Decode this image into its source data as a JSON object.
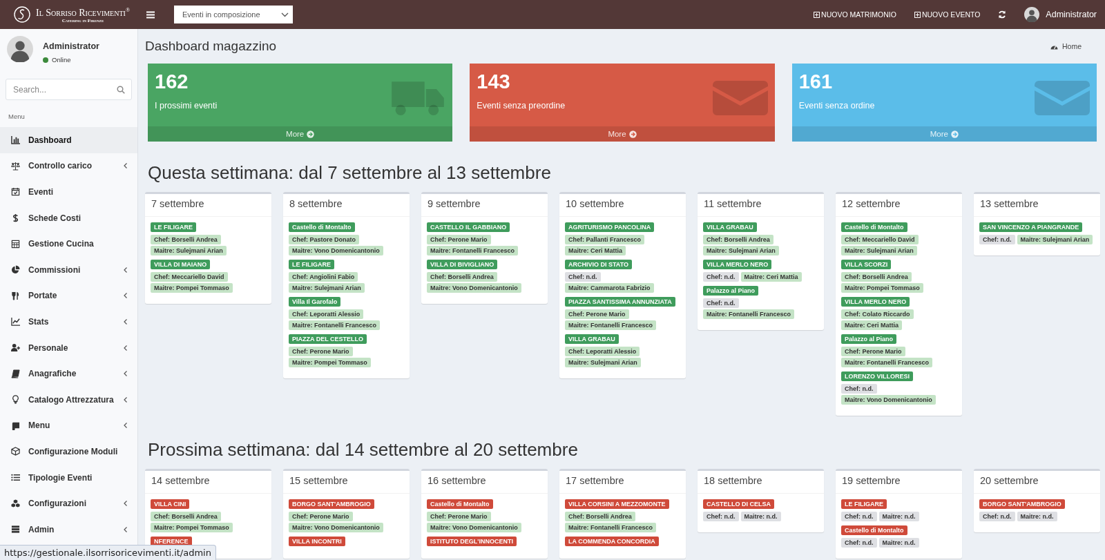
{
  "header": {
    "logo": {
      "name": "Il Sorriso Ricevimenti$^{®}$",
      "tagline": "Catering in Firenze"
    },
    "filter": {
      "value": "Eventi in composizione"
    },
    "actions": [
      {
        "label": "NUOVO MATRIMONIO"
      },
      {
        "label": "NUOVO EVENTO"
      }
    ],
    "user": "Administrator"
  },
  "sidebar": {
    "user": {
      "name": "Administrator",
      "status": "Online",
      "online": true
    },
    "search": {
      "placeholder": "Search..."
    },
    "section": "Menu",
    "items": [
      {
        "label": "Dashboard",
        "kind": "bar-chart",
        "submenu": false,
        "selected": true
      },
      {
        "label": "Controllo carico",
        "kind": "scale",
        "submenu": true,
        "selected": false
      },
      {
        "label": "Eventi",
        "kind": "calendar",
        "submenu": false,
        "selected": false
      },
      {
        "label": "Schede Costi",
        "kind": "dollar",
        "submenu": false,
        "selected": false
      },
      {
        "label": "Gestione Cucina",
        "kind": "calculator",
        "submenu": false,
        "selected": false
      },
      {
        "label": "Commissioni",
        "kind": "pie",
        "submenu": true,
        "selected": false
      },
      {
        "label": "Portate",
        "kind": "utensils",
        "submenu": true,
        "selected": false
      },
      {
        "label": "Stats",
        "kind": "line-chart",
        "submenu": true,
        "selected": false
      },
      {
        "label": "Personale",
        "kind": "user-plus",
        "submenu": true,
        "selected": false
      },
      {
        "label": "Anagrafiche",
        "kind": "book",
        "submenu": true,
        "selected": false
      },
      {
        "label": "Catalogo Attrezzatura",
        "kind": "bulb",
        "submenu": true,
        "selected": false
      },
      {
        "label": "Menu",
        "kind": "scroll",
        "submenu": true,
        "selected": false
      },
      {
        "label": "Configurazione Moduli",
        "kind": "cube",
        "submenu": false,
        "selected": false
      },
      {
        "label": "Tipologie Eventi",
        "kind": "list",
        "submenu": false,
        "selected": false
      },
      {
        "label": "Configurazioni",
        "kind": "cubes",
        "submenu": true,
        "selected": false
      },
      {
        "label": "Admin",
        "kind": "server",
        "submenu": true,
        "selected": false
      }
    ]
  },
  "page": {
    "title": "Dashboard magazzino",
    "breadcrumb": "Home"
  },
  "stats": [
    {
      "value": "162",
      "label": "I prossimi eventi",
      "link": "More",
      "kind": "truck",
      "color": "#4aa563"
    },
    {
      "value": "143",
      "label": "Eventi senza preordine",
      "link": "More",
      "kind": "envelope",
      "color": "#d65a46"
    },
    {
      "value": "161",
      "label": "Eventi senza ordine",
      "link": "More",
      "kind": "envelope",
      "color": "#5bbde9"
    }
  ],
  "weeks": [
    {
      "title": "Questa settimana: dal 7 settembre al 13 settembre",
      "days": [
        {
          "date": "7 settembre",
          "events": [
            {
              "venue": "LE FILIGARE",
              "color": "#3f9c5c",
              "staff": [
                {
                  "text": "Chef: Borselli Andrea",
                  "assigned": true
                },
                {
                  "text": "Maitre: Sulejmani Arian",
                  "assigned": true
                }
              ]
            },
            {
              "venue": "VILLA DI MAIANO",
              "color": "#3f9c5c",
              "staff": [
                {
                  "text": "Chef: Meccariello David",
                  "assigned": true
                },
                {
                  "text": "Maitre: Pompei Tommaso",
                  "assigned": true
                }
              ]
            }
          ]
        },
        {
          "date": "8 settembre",
          "events": [
            {
              "venue": "Castello di Montalto",
              "color": "#3f9c5c",
              "staff": [
                {
                  "text": "Chef: Pastore Donato",
                  "assigned": true
                },
                {
                  "text": "Maitre: Vono Domenicantonio",
                  "assigned": true
                }
              ]
            },
            {
              "venue": "LE FILIGARE",
              "color": "#3f9c5c",
              "staff": [
                {
                  "text": "Chef: Angiolini Fabio",
                  "assigned": true
                },
                {
                  "text": "Maitre: Sulejmani Arian",
                  "assigned": true
                }
              ]
            },
            {
              "venue": "Villa Il Garofalo",
              "color": "#3f9c5c",
              "staff": [
                {
                  "text": "Chef: Leporatti Alessio",
                  "assigned": true
                },
                {
                  "text": "Maitre: Fontanelli Francesco",
                  "assigned": true
                }
              ]
            },
            {
              "venue": "PIAZZA DEL CESTELLO",
              "color": "#3f9c5c",
              "staff": [
                {
                  "text": "Chef: Perone Mario",
                  "assigned": true
                },
                {
                  "text": "Maitre: Pompei Tommaso",
                  "assigned": true
                }
              ]
            }
          ]
        },
        {
          "date": "9 settembre",
          "events": [
            {
              "venue": "CASTELLO IL GABBIANO",
              "color": "#3f9c5c",
              "staff": [
                {
                  "text": "Chef: Perone Mario",
                  "assigned": true
                },
                {
                  "text": "Maitre: Fontanelli Francesco",
                  "assigned": true
                }
              ]
            },
            {
              "venue": "VILLA DI BIVIGLIANO",
              "color": "#3f9c5c",
              "staff": [
                {
                  "text": "Chef: Borselli Andrea",
                  "assigned": true
                },
                {
                  "text": "Maitre: Vono Domenicantonio",
                  "assigned": true
                }
              ]
            }
          ]
        },
        {
          "date": "10 settembre",
          "events": [
            {
              "venue": "AGRITURISMO PANCOLINA",
              "color": "#3f9c5c",
              "staff": [
                {
                  "text": "Chef: Pallanti Francesco",
                  "assigned": true
                },
                {
                  "text": "Maitre: Ceri Mattia",
                  "assigned": true
                }
              ]
            },
            {
              "venue": "ARCHIVIO DI STATO",
              "color": "#3f9c5c",
              "staff": [
                {
                  "text": "Chef: n.d.",
                  "assigned": false
                },
                {
                  "text": "Maitre: Cammarota Fabrizio",
                  "assigned": true
                }
              ]
            },
            {
              "venue": "PIAZZA SANTISSIMA ANNUNZIATA",
              "color": "#3f9c5c",
              "staff": [
                {
                  "text": "Chef: Perone Mario",
                  "assigned": true
                },
                {
                  "text": "Maitre: Fontanelli Francesco",
                  "assigned": true
                }
              ]
            },
            {
              "venue": "VILLA GRABAU",
              "color": "#3f9c5c",
              "staff": [
                {
                  "text": "Chef: Leporatti Alessio",
                  "assigned": true
                },
                {
                  "text": "Maitre: Sulejmani Arian",
                  "assigned": true
                }
              ]
            }
          ]
        },
        {
          "date": "11 settembre",
          "events": [
            {
              "venue": "VILLA GRABAU",
              "color": "#3f9c5c",
              "staff": [
                {
                  "text": "Chef: Borselli Andrea",
                  "assigned": true
                },
                {
                  "text": "Maitre: Sulejmani Arian",
                  "assigned": true
                }
              ]
            },
            {
              "venue": "VILLA MERLO NERO",
              "color": "#3f9c5c",
              "staff": [
                {
                  "text": "Chef: n.d.",
                  "assigned": false
                },
                {
                  "text": "Maitre: Ceri Mattia",
                  "assigned": true
                }
              ]
            },
            {
              "venue": "Palazzo al Piano",
              "color": "#3f9c5c",
              "staff": [
                {
                  "text": "Chef: n.d.",
                  "assigned": false
                },
                {
                  "text": "Maitre: Fontanelli Francesco",
                  "assigned": true
                }
              ]
            }
          ]
        },
        {
          "date": "12 settembre",
          "events": [
            {
              "venue": "Castello di Montalto",
              "color": "#3f9c5c",
              "staff": [
                {
                  "text": "Chef: Meccariello David",
                  "assigned": true
                },
                {
                  "text": "Maitre: Sulejmani Arian",
                  "assigned": true
                }
              ]
            },
            {
              "venue": "VILLA SCORZI",
              "color": "#3f9c5c",
              "staff": [
                {
                  "text": "Chef: Borselli Andrea",
                  "assigned": true
                },
                {
                  "text": "Maitre: Pompei Tommaso",
                  "assigned": true
                }
              ]
            },
            {
              "venue": "VILLA MERLO NERO",
              "color": "#3f9c5c",
              "staff": [
                {
                  "text": "Chef: Colato Riccardo",
                  "assigned": true
                },
                {
                  "text": "Maitre: Ceri Mattia",
                  "assigned": true
                }
              ]
            },
            {
              "venue": "Palazzo al Piano",
              "color": "#3f9c5c",
              "staff": [
                {
                  "text": "Chef: Perone Mario",
                  "assigned": true
                },
                {
                  "text": "Maitre: Fontanelli Francesco",
                  "assigned": true
                }
              ]
            },
            {
              "venue": "LORENZO VILLORESI",
              "color": "#3f9c5c",
              "staff": [
                {
                  "text": "Chef: n.d.",
                  "assigned": false
                },
                {
                  "text": "Maitre: Vono Domenicantonio",
                  "assigned": true
                }
              ]
            }
          ]
        },
        {
          "date": "13 settembre",
          "events": [
            {
              "venue": "SAN VINCENZO A PIANGRANDE",
              "color": "#3f9c5c",
              "staff": [
                {
                  "text": "Chef: n.d.",
                  "assigned": false
                },
                {
                  "text": "Maitre: Sulejmani Arian",
                  "assigned": true
                }
              ]
            }
          ]
        }
      ]
    },
    {
      "title": "Prossima settimana: dal 14 settembre al 20 settembre",
      "days": [
        {
          "date": "14 settembre",
          "events": [
            {
              "venue": "VILLA CINI",
              "color": "#cf4a3a",
              "staff": [
                {
                  "text": "Chef: Borselli Andrea",
                  "assigned": true
                },
                {
                  "text": "Maitre: Pompei Tommaso",
                  "assigned": true
                }
              ]
            },
            {
              "venue": "NFERENCE",
              "color": "#cf4a3a"
            }
          ]
        },
        {
          "date": "15 settembre",
          "events": [
            {
              "venue": "BORGO SANT'AMBROGIO",
              "color": "#cf4a3a",
              "staff": [
                {
                  "text": "Chef: Perone Mario",
                  "assigned": true
                },
                {
                  "text": "Maitre: Vono Domenicantonio",
                  "assigned": true
                }
              ]
            },
            {
              "venue": "VILLA INCONTRI",
              "color": "#cf4a3a"
            }
          ]
        },
        {
          "date": "16 settembre",
          "events": [
            {
              "venue": "Castello di Montalto",
              "color": "#cf4a3a",
              "staff": [
                {
                  "text": "Chef: Perone Mario",
                  "assigned": true
                },
                {
                  "text": "Maitre: Vono Domenicantonio",
                  "assigned": true
                }
              ]
            },
            {
              "venue": "ISTITUTO DEGL'INNOCENTI",
              "color": "#cf4a3a"
            }
          ]
        },
        {
          "date": "17 settembre",
          "events": [
            {
              "venue": "VILLA CORSINI A MEZZOMONTE",
              "color": "#cf4a3a",
              "staff": [
                {
                  "text": "Chef: Borselli Andrea",
                  "assigned": true
                },
                {
                  "text": "Maitre: Fontanelli Francesco",
                  "assigned": true
                }
              ]
            },
            {
              "venue": "LA COMMENDA CONCORDIA",
              "color": "#cf4a3a"
            }
          ]
        },
        {
          "date": "18 settembre",
          "events": [
            {
              "venue": "CASTELLO DI CELSA",
              "color": "#cf4a3a",
              "staff": [
                {
                  "text": "Chef: n.d.",
                  "assigned": false
                },
                {
                  "text": "Maitre: n.d.",
                  "assigned": false
                }
              ]
            }
          ]
        },
        {
          "date": "19 settembre",
          "events": [
            {
              "venue": "LE FILIGARE",
              "color": "#cf4a3a",
              "staff": [
                {
                  "text": "Chef: n.d.",
                  "assigned": false
                },
                {
                  "text": "Maitre: n.d.",
                  "assigned": false
                }
              ]
            },
            {
              "venue": "Castello di Montalto",
              "color": "#cf4a3a",
              "staff": [
                {
                  "text": "Chef: n.d.",
                  "assigned": false
                },
                {
                  "text": "Maitre: n.d.",
                  "assigned": false
                }
              ]
            }
          ]
        },
        {
          "date": "20 settembre",
          "events": [
            {
              "venue": "BORGO SANT'AMBROGIO",
              "color": "#cf4a3a",
              "staff": [
                {
                  "text": "Chef: n.d.",
                  "assigned": false
                },
                {
                  "text": "Maitre: n.d.",
                  "assigned": false
                }
              ]
            }
          ]
        }
      ]
    }
  ],
  "status_url": "https://gestionale.ilsorrisoricevimenti.it/admin"
}
